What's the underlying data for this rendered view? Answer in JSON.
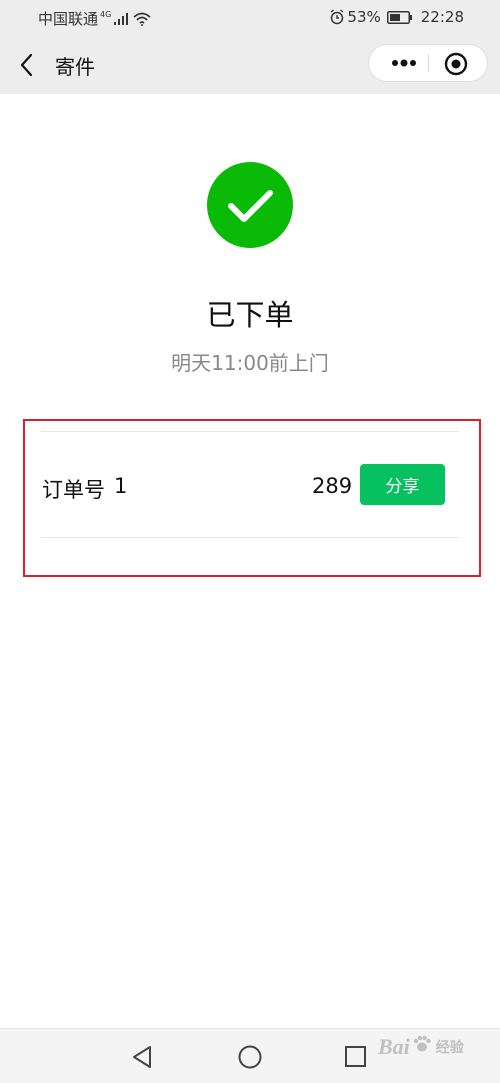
{
  "status_bar": {
    "carrier": "中国联通",
    "network_badge": "4G",
    "battery_percent": "53%",
    "time": "22:28"
  },
  "nav": {
    "title": "寄件"
  },
  "result": {
    "title": "已下单",
    "subtitle": "明天11:00前上门"
  },
  "order": {
    "label": "订单号",
    "number_visible_start": "1",
    "number_visible_end": "289",
    "share_label": "分享"
  },
  "watermark": {
    "text": "Bai",
    "suffix": "经验"
  },
  "colors": {
    "success_green": "#07c160",
    "highlight_red": "#d9202b",
    "nav_background": "#ededed"
  }
}
